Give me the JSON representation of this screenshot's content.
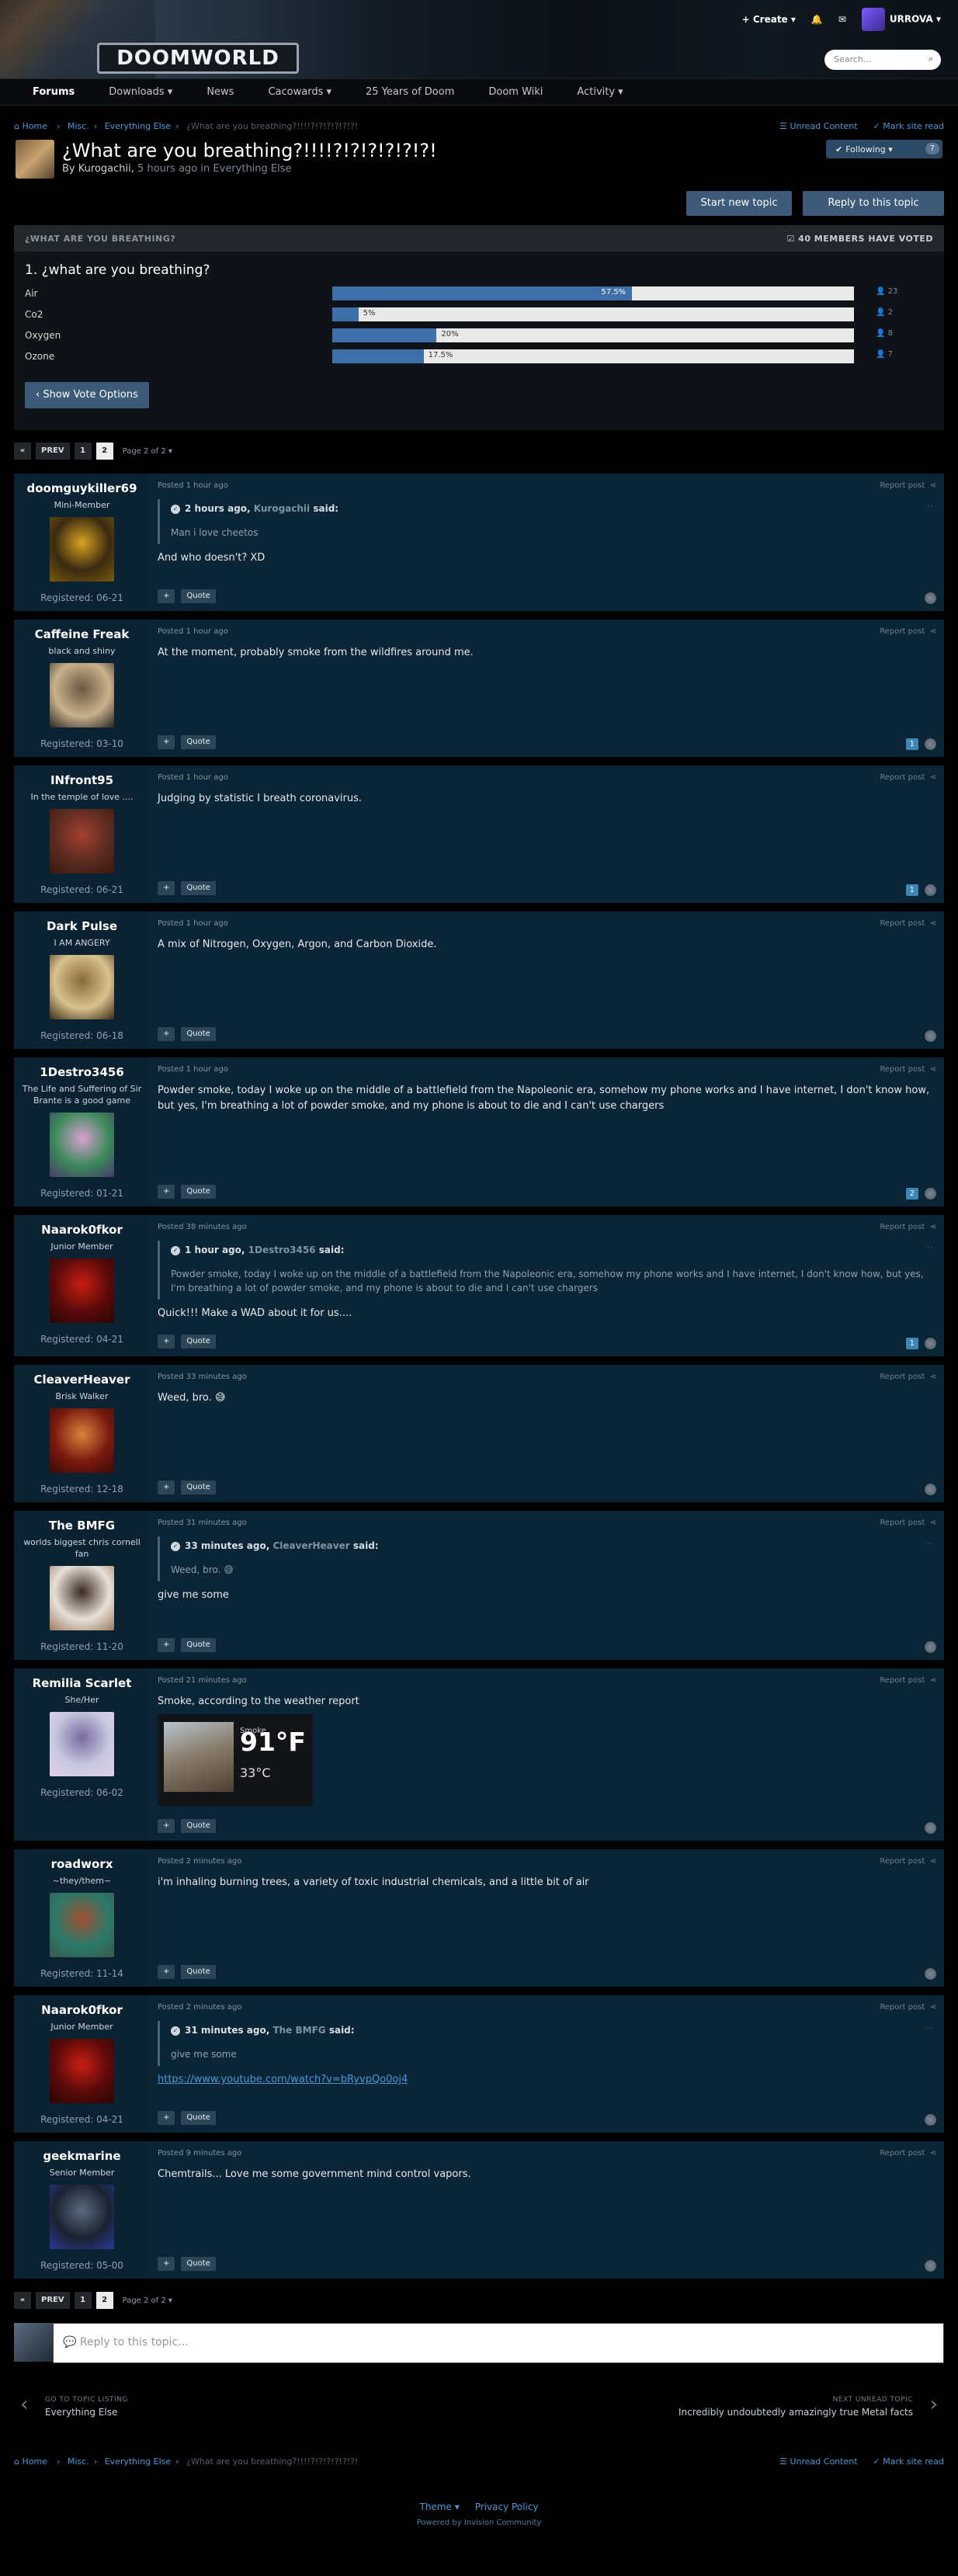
{
  "header": {
    "logo_text": "DOOMWORLD",
    "create_label": "Create",
    "username": "URROVA",
    "search_placeholder": "Search..."
  },
  "nav": {
    "items": [
      {
        "label": "Forums"
      },
      {
        "label": "Downloads"
      },
      {
        "label": "News"
      },
      {
        "label": "Cacowards"
      },
      {
        "label": "25 Years of Doom"
      },
      {
        "label": "Doom Wiki"
      },
      {
        "label": "Activity"
      }
    ]
  },
  "breadcrumb": {
    "home": "Home",
    "misc": "Misc.",
    "section": "Everything Else",
    "current": "¿What are you breathing?!!!!?!?!?!?!?!?!",
    "unread": "Unread Content",
    "mark_read": "Mark site read"
  },
  "topic": {
    "title": "¿What are you breathing?!!!!?!?!?!?!?!?!",
    "by_prefix": "By",
    "author": "Kurogachii",
    "time_ago": "5 hours ago",
    "in_prefix": "in",
    "section": "Everything Else",
    "following_label": "Following",
    "following_count": "7",
    "start_label": "Start new topic",
    "reply_label": "Reply to this topic"
  },
  "poll": {
    "header": "¿WHAT ARE YOU BREATHING?",
    "voters": "40 MEMBERS HAVE VOTED",
    "question": "1. ¿what are you breathing?",
    "options": [
      {
        "label": "Air",
        "pct": 57.5,
        "pct_label": "57.5%",
        "votes": "23"
      },
      {
        "label": "Co2",
        "pct": 5,
        "pct_label": "5%",
        "votes": "2"
      },
      {
        "label": "Oxygen",
        "pct": 20,
        "pct_label": "20%",
        "votes": "8"
      },
      {
        "label": "Ozone",
        "pct": 17.5,
        "pct_label": "17.5%",
        "votes": "7"
      }
    ],
    "show_vote_label": "Show Vote Options"
  },
  "pager": {
    "prev": "PREV",
    "page1": "1",
    "page2": "2",
    "info": "Page 2 of 2"
  },
  "posts": [
    {
      "user": "doomguykiller69",
      "title": "Mini-Member",
      "registered": "Registered: 06-21",
      "posted": "Posted 1 hour ago",
      "avatar": [
        "#3a2a10",
        "#d9a422",
        "#7a5a10"
      ],
      "quote": {
        "author_time": "2 hours ago,",
        "author": "Kurogachii",
        "said": "said:",
        "text": "Man i love cheetos"
      },
      "text": "And who doesn't? XD",
      "reactions": ""
    },
    {
      "user": "Caffeine Freak",
      "title": "black and shiny",
      "registered": "Registered: 03-10",
      "posted": "Posted 1 hour ago",
      "avatar": [
        "#c8b28c",
        "#6b5840",
        "#2a2520"
      ],
      "text": "At the moment, probably smoke from the wildfires around me.",
      "reactions": "1"
    },
    {
      "user": "INfront95",
      "title": "In the temple of love ....",
      "registered": "Registered: 06-21",
      "posted": "Posted 1 hour ago",
      "avatar": [
        "#5a2b20",
        "#a34030",
        "#3b1810"
      ],
      "text": "Judging by statistic I breath coronavirus.",
      "reactions": "1"
    },
    {
      "user": "Dark Pulse",
      "title": "I AM ANGERY",
      "registered": "Registered: 06-18",
      "posted": "Posted 1 hour ago",
      "avatar": [
        "#d9c28e",
        "#8a6a3a",
        "#3a2a15"
      ],
      "text": "A mix of Nitrogen, Oxygen, Argon, and Carbon Dioxide.",
      "reactions": ""
    },
    {
      "user": "1Destro3456",
      "title": "The Life and Suffering of Sir Brante is a good game",
      "registered": "Registered: 01-21",
      "posted": "Posted 1 hour ago",
      "avatar": [
        "#3a8a5a",
        "#d9a0d0",
        "#4a3a6a"
      ],
      "text": "Powder smoke, today I woke up on the middle of a battlefield from the Napoleonic era, somehow my phone works and I have internet, I don't know how, but yes, I'm breathing a lot of powder smoke, and my phone is about to die and I can't use chargers",
      "reactions": "2"
    },
    {
      "user": "Naarok0fkor",
      "title": "Junior Member",
      "registered": "Registered: 04-21",
      "posted": "Posted 38 minutes ago",
      "avatar": [
        "#5a0a0a",
        "#c81e10",
        "#2a0505"
      ],
      "quote": {
        "author_time": "1 hour ago,",
        "author": "1Destro3456",
        "said": "said:",
        "text": "Powder smoke, today I woke up on the middle of a battlefield from the Napoleonic era, somehow my phone works and I have internet, I don't know how, but yes, I'm breathing a lot of powder smoke, and my phone is about to die and I can't use chargers"
      },
      "text": "Quick!!! Make a WAD about it for us....",
      "reactions": "1"
    },
    {
      "user": "CleaverHeaver",
      "title": "Brisk Walker",
      "registered": "Registered: 12-18",
      "posted": "Posted 33 minutes ago",
      "avatar": [
        "#7a1a10",
        "#d9843a",
        "#3a0a05"
      ],
      "text": "Weed, bro. 😅",
      "reactions": ""
    },
    {
      "user": "The BMFG",
      "title": "worlds biggest chris cornell fan",
      "registered": "Registered: 11-20",
      "posted": "Posted 31 minutes ago",
      "avatar": [
        "#e8e0d8",
        "#3a2a20",
        "#9a7a60"
      ],
      "quote": {
        "author_time": "33 minutes ago,",
        "author": "CleaverHeaver",
        "said": "said:",
        "text": "Weed, bro. 😅"
      },
      "text": "give me some",
      "reactions": ""
    },
    {
      "user": "Remilia Scarlet",
      "title": "She/Her",
      "registered": "Registered: 06-02",
      "posted": "Posted 21 minutes ago",
      "avatar": [
        "#c8c8e0",
        "#7a6aa0",
        "#e0d0e8"
      ],
      "text": "Smoke, according to the weather report",
      "weather": {
        "label": "Smoke",
        "temp_f": "91°F",
        "temp_c": "33°C"
      },
      "reactions": ""
    },
    {
      "user": "roadworx",
      "title": "~they/them~",
      "registered": "Registered: 11-14",
      "posted": "Posted 2 minutes ago",
      "avatar": [
        "#2a7a6a",
        "#a05030",
        "#3a5a4a"
      ],
      "text": "i'm inhaling burning trees, a variety of toxic industrial chemicals, and a little bit of air",
      "reactions": ""
    },
    {
      "user": "Naarok0fkor",
      "title": "Junior Member",
      "registered": "Registered: 04-21",
      "posted": "Posted 2 minutes ago",
      "avatar": [
        "#5a0a0a",
        "#c81e10",
        "#2a0505"
      ],
      "quote": {
        "author_time": "31 minutes ago,",
        "author": "The BMFG",
        "said": "said:",
        "text": "give me some"
      },
      "text": "",
      "link": "https://www.youtube.com/watch?v=bRyvpQo0oj4",
      "reactions": ""
    },
    {
      "user": "geekmarine",
      "title": "Senior Member",
      "registered": "Registered: 05-00",
      "posted": "Posted 9 minutes ago",
      "avatar": [
        "#1a2230",
        "#5a6a80",
        "#2a3a9a"
      ],
      "text": "Chemtrails... Love me some government mind control vapors.",
      "reactions": ""
    }
  ],
  "post_ui": {
    "report": "Report post",
    "quote": "Quote",
    "plus": "+"
  },
  "reply_box": {
    "placeholder": "Reply to this topic..."
  },
  "topic_nav": {
    "go_to_label": "GO TO TOPIC LISTING",
    "go_to_value": "Everything Else",
    "next_label": "NEXT UNREAD TOPIC",
    "next_value": "Incredibly undoubtedly amazingly true Metal facts"
  },
  "footer": {
    "theme": "Theme",
    "privacy": "Privacy Policy",
    "powered": "Powered by Invision Community"
  }
}
